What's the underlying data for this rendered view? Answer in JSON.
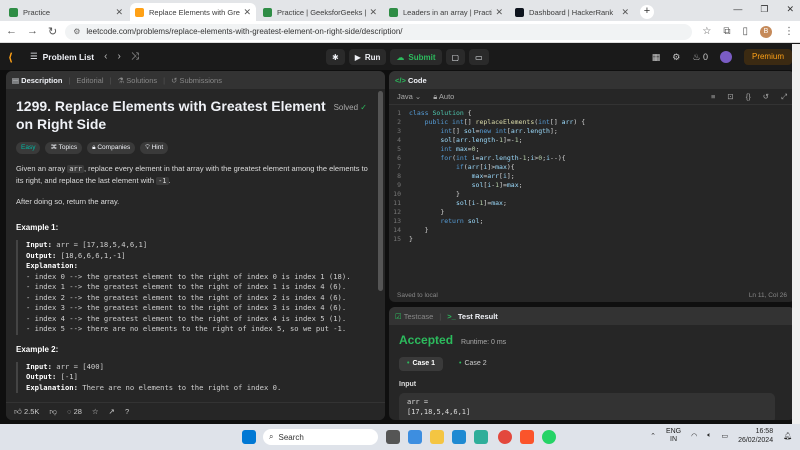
{
  "browser": {
    "tabs": [
      {
        "title": "Practice",
        "active": false,
        "color": "#2f8d46"
      },
      {
        "title": "Replace Elements with Greatest",
        "active": true,
        "color": "#ffa116"
      },
      {
        "title": "Practice | GeeksforGeeks | A co",
        "active": false,
        "color": "#2f8d46"
      },
      {
        "title": "Leaders in an array | Practice |",
        "active": false,
        "color": "#2f8d46"
      },
      {
        "title": "Dashboard | HackerRank",
        "active": false,
        "color": "#0e141e"
      }
    ],
    "url": "leetcode.com/problems/replace-elements-with-greatest-element-on-right-side/description/",
    "profile_initial": "B"
  },
  "header": {
    "problem_list": "Problem List",
    "run": "Run",
    "submit": "Submit",
    "streak": "0",
    "premium": "Premium"
  },
  "left_panel": {
    "tabs": [
      "Description",
      "Editorial",
      "Solutions",
      "Submissions"
    ],
    "title": "1299. Replace Elements with Greatest Element on Right Side",
    "solved": "Solved",
    "tags": [
      "Easy",
      "Topics",
      "Companies",
      "Hint"
    ],
    "para1_a": "Given an array ",
    "para1_code": "arr",
    "para1_b": ", replace every element in that array with the greatest element among the elements to its right, and replace the last element with ",
    "para1_code2": "-1",
    "para1_c": ".",
    "para2": "After doing so, return the array.",
    "example1": {
      "heading": "Example 1:",
      "input_label": "Input:",
      "input": "arr = [17,18,5,4,6,1]",
      "output_label": "Output:",
      "output": "[18,6,6,6,1,-1]",
      "explanation_label": "Explanation:",
      "lines": [
        "- index 0 --> the greatest element to the right of index 0 is index 1 (18).",
        "- index 1 --> the greatest element to the right of index 1 is index 4 (6).",
        "- index 2 --> the greatest element to the right of index 2 is index 4 (6).",
        "- index 3 --> the greatest element to the right of index 3 is index 4 (6).",
        "- index 4 --> the greatest element to the right of index 4 is index 5 (1).",
        "- index 5 --> there are no elements to the right of index 5, so we put -1."
      ]
    },
    "example2": {
      "heading": "Example 2:",
      "input_label": "Input:",
      "input": "arr = [400]",
      "output_label": "Output:",
      "output": "[-1]",
      "explanation_label": "Explanation:",
      "explanation": "There are no elements to the right of index 0."
    },
    "footer": {
      "likes": "2.5K",
      "comments": "28"
    }
  },
  "code_panel": {
    "title": "Code",
    "language": "Java",
    "mode": "Auto",
    "status": "Saved to local",
    "cursor": "Ln 11, Col 26"
  },
  "result_panel": {
    "tabs": [
      "Testcase",
      "Test Result"
    ],
    "verdict": "Accepted",
    "runtime": "Runtime: 0 ms",
    "cases": [
      "Case 1",
      "Case 2"
    ],
    "input_label": "Input",
    "input_name": "arr =",
    "input_value": "[17,18,5,4,6,1]"
  },
  "taskbar": {
    "search": "Search",
    "lang1": "ENG",
    "lang2": "IN",
    "time": "16:58",
    "date": "26/02/2024"
  }
}
